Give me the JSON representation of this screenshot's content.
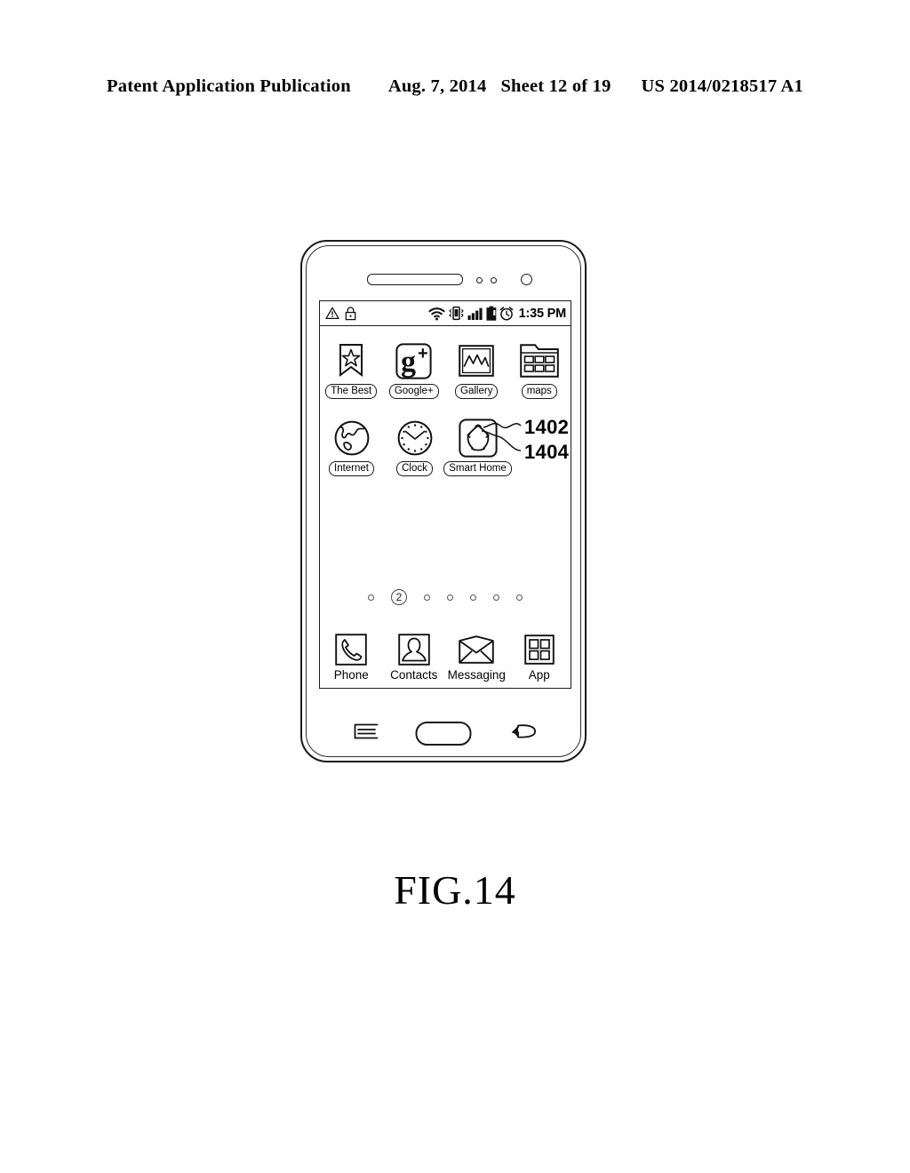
{
  "header": {
    "publication": "Patent Application Publication",
    "date": "Aug. 7, 2014",
    "sheet": "Sheet 12 of 19",
    "patent_number": "US 2014/0218517 A1"
  },
  "figure": {
    "caption": "FIG.14"
  },
  "device": {
    "hardware": {
      "speaker": "earpiece-speaker",
      "sensor_1": "proximity-sensor",
      "sensor_2": "light-sensor",
      "camera": "front-camera",
      "menu_button": "menu-button",
      "home_button": "home-button",
      "back_button": "back-button"
    },
    "status_bar": {
      "left_icons": [
        "warning-icon",
        "lock-icon"
      ],
      "right_icons": [
        "wifi-icon",
        "vibrate-icon",
        "signal-icon",
        "battery-icon",
        "alarm-icon"
      ],
      "time": "1:35 PM"
    },
    "home_screen": {
      "rows": [
        [
          {
            "label": "The Best",
            "icon": "bookmark-star-icon"
          },
          {
            "label": "Google+",
            "icon": "google-plus-icon"
          },
          {
            "label": "Gallery",
            "icon": "gallery-icon"
          },
          {
            "label": "maps",
            "icon": "maps-folder-icon"
          }
        ],
        [
          {
            "label": "Internet",
            "icon": "globe-icon"
          },
          {
            "label": "Clock",
            "icon": "clock-icon"
          },
          {
            "label": "Smart Home",
            "icon": "smart-home-icon"
          }
        ]
      ],
      "reference_numerals": [
        {
          "id": "1402",
          "points_to": "smart-home-icon-frame"
        },
        {
          "id": "1404",
          "points_to": "smart-home-icon-glyph"
        }
      ],
      "page_indicator": {
        "total_pages": 7,
        "current_page": "2",
        "current_index": 1
      },
      "dock": [
        {
          "label": "Phone",
          "icon": "phone-handset-icon"
        },
        {
          "label": "Contacts",
          "icon": "contact-person-icon"
        },
        {
          "label": "Messaging",
          "icon": "envelope-icon"
        },
        {
          "label": "App",
          "icon": "app-grid-icon"
        }
      ]
    }
  },
  "colors": {
    "line": "#1a1a1a",
    "background": "#ffffff",
    "dot": "#555555"
  }
}
